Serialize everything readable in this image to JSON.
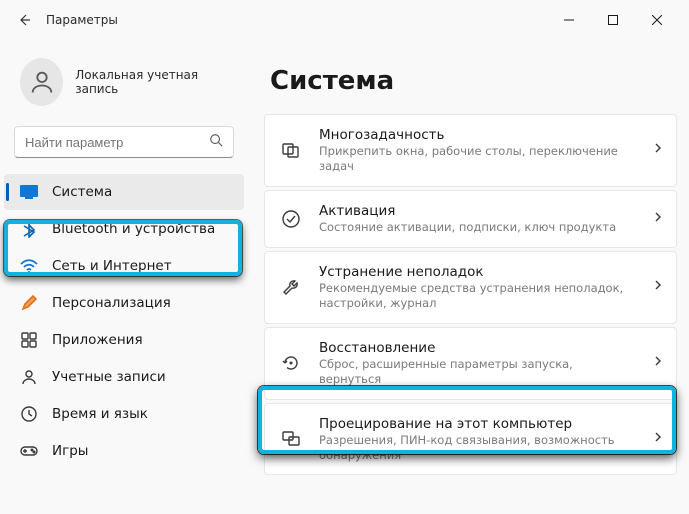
{
  "window": {
    "title": "Параметры"
  },
  "profile": {
    "subtitle": "Локальная учетная запись"
  },
  "search": {
    "placeholder": "Найти параметр"
  },
  "sidebar": {
    "items": [
      {
        "label": "Система"
      },
      {
        "label": "Bluetooth и устройства"
      },
      {
        "label": "Сеть и Интернет"
      },
      {
        "label": "Персонализация"
      },
      {
        "label": "Приложения"
      },
      {
        "label": "Учетные записи"
      },
      {
        "label": "Время и язык"
      },
      {
        "label": "Игры"
      }
    ]
  },
  "page": {
    "title": "Система",
    "cards": [
      {
        "title": "Многозадачность",
        "sub": "Прикрепить окна, рабочие столы, переключение задач"
      },
      {
        "title": "Активация",
        "sub": "Состояние активации, подписки, ключ продукта"
      },
      {
        "title": "Устранение неполадок",
        "sub": "Рекомендуемые средства устранения неполадок, настройки, журнал"
      },
      {
        "title": "Восстановление",
        "sub": "Сброс, расширенные параметры запуска, вернуться"
      },
      {
        "title": "Проецирование на этот компьютер",
        "sub": "Разрешения, ПИН-код связывания, возможность обнаружения"
      }
    ]
  }
}
